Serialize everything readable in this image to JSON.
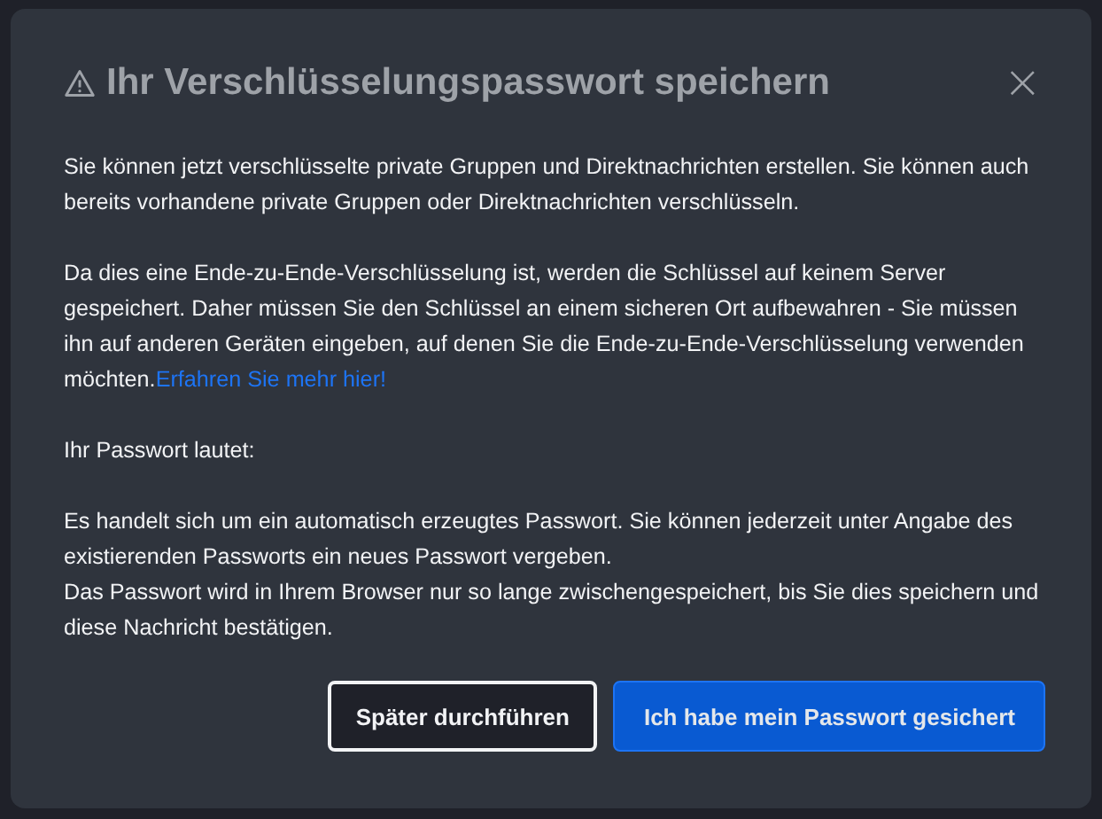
{
  "dialog": {
    "title": "Ihr Verschlüsselungspasswort speichern",
    "close": "×",
    "paragraphs": [
      {
        "lines": [
          "Sie können jetzt verschlüsselte private Gruppen und Direktnachrichten erstellen. Sie können auch bereits vorhandene private Gruppen oder Direktnachrichten verschlüsseln."
        ]
      },
      {
        "lines": [
          "Da dies eine Ende-zu-Ende-Verschlüsselung ist, werden die Schlüssel auf keinem Server gespeichert. Daher müssen Sie den Schlüssel an einem sicheren Ort aufbewahren - Sie müssen ihn auf anderen Geräten eingeben, auf denen Sie die Ende-zu-Ende-Verschlüsselung verwenden möchten."
        ],
        "link": "Erfahren Sie mehr hier!"
      },
      {
        "lines": [
          "Ihr Passwort lautet:"
        ]
      },
      {
        "lines": [
          "Es handelt sich um ein automatisch erzeugtes Passwort. Sie können jederzeit unter Angabe des existierenden Passworts ein neues Passwort vergeben.",
          "Das Passwort wird in Ihrem Browser nur so lange zwischengespeichert, bis Sie dies speichern und diese Nachricht bestätigen."
        ]
      }
    ],
    "buttons": [
      {
        "label": "Später durchführen",
        "kind": "secondary"
      },
      {
        "label": "Ich habe mein Passwort gesichert",
        "kind": "primary"
      }
    ]
  }
}
